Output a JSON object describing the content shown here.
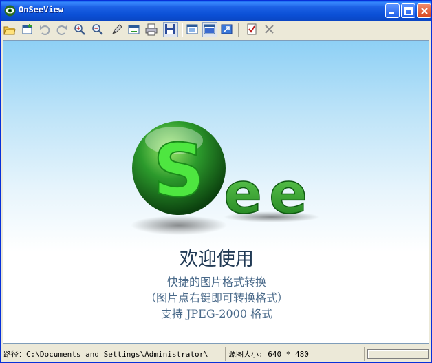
{
  "window": {
    "title": "OnSeeView"
  },
  "toolbar": {
    "tools": [
      "open-folder-icon",
      "new-window-icon",
      "undo-icon",
      "redo-icon",
      "zoom-in-icon",
      "zoom-out-icon",
      "pen-tool-icon",
      "screen-capture-icon",
      "print-icon",
      "save-icon",
      "fit-window-icon",
      "actual-size-icon",
      "fullscreen-icon",
      "checklist-icon",
      "close-x-icon"
    ]
  },
  "canvas": {
    "logo_letters": [
      "S",
      "e",
      "e"
    ],
    "welcome_title": "欢迎使用",
    "line1": "快捷的图片格式转换",
    "line2": "（图片点右键即可转换格式）",
    "line3": "支持 JPEG-2000 格式"
  },
  "statusbar": {
    "path": "路径：C:\\Documents and Settings\\Administrator\\",
    "size": "源图大小: 640 * 480"
  },
  "colors": {
    "titlebar": "#0b50d6",
    "logo_green": "#2fa82f",
    "background_top": "#8ed0f5"
  }
}
